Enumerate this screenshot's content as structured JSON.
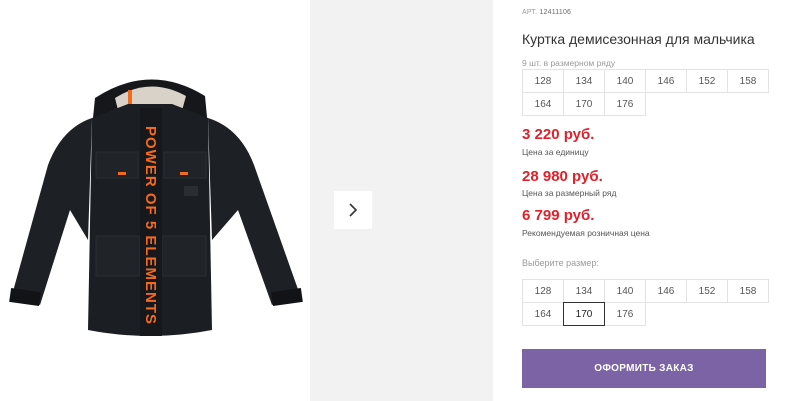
{
  "product": {
    "article_label": "АРТ.",
    "article_number": "12411106",
    "title": "Куртка демисезонная для мальчика",
    "image_print_text": "POWER OF 5 ELEMENTS"
  },
  "pack": {
    "note": "9 шт. в размерном ряду",
    "sizes": [
      "128",
      "134",
      "140",
      "146",
      "152",
      "158",
      "164",
      "170",
      "176"
    ]
  },
  "prices": [
    {
      "value": "3 220 руб.",
      "label": "Цена за единицу"
    },
    {
      "value": "28 980 руб.",
      "label": "Цена за размерный ряд"
    },
    {
      "value": "6 799 руб.",
      "label": "Рекомендуемая розничная цена"
    }
  ],
  "size_select": {
    "label": "Выберите размер:",
    "sizes": [
      "128",
      "134",
      "140",
      "146",
      "152",
      "158",
      "164",
      "170",
      "176"
    ],
    "selected": "170"
  },
  "actions": {
    "order_label": "ОФОРМИТЬ ЗАКАЗ"
  },
  "colors": {
    "price": "#e0212b",
    "accent": "#7b63a6",
    "jacket": "#1b1e22",
    "print": "#f26a21"
  },
  "icons": {
    "next": "chevron-right-icon"
  }
}
